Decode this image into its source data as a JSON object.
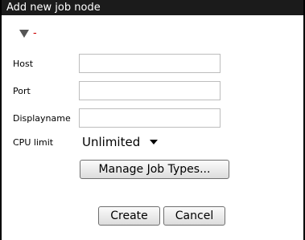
{
  "dialog": {
    "title": "Add new job node",
    "collapse_indicator": "-",
    "fields": {
      "host_label": "Host",
      "host_value": "",
      "port_label": "Port",
      "port_value": "",
      "displayname_label": "Displayname",
      "displayname_value": "",
      "cpu_label": "CPU limit",
      "cpu_value": "Unlimited"
    },
    "buttons": {
      "manage_job_types": "Manage Job Types...",
      "create": "Create",
      "cancel": "Cancel"
    }
  },
  "colors": {
    "titlebar_bg": "#1b1b1b",
    "accent_red": "#cc0000"
  },
  "icons": [
    "triangle-down-icon",
    "caret-down-icon"
  ]
}
